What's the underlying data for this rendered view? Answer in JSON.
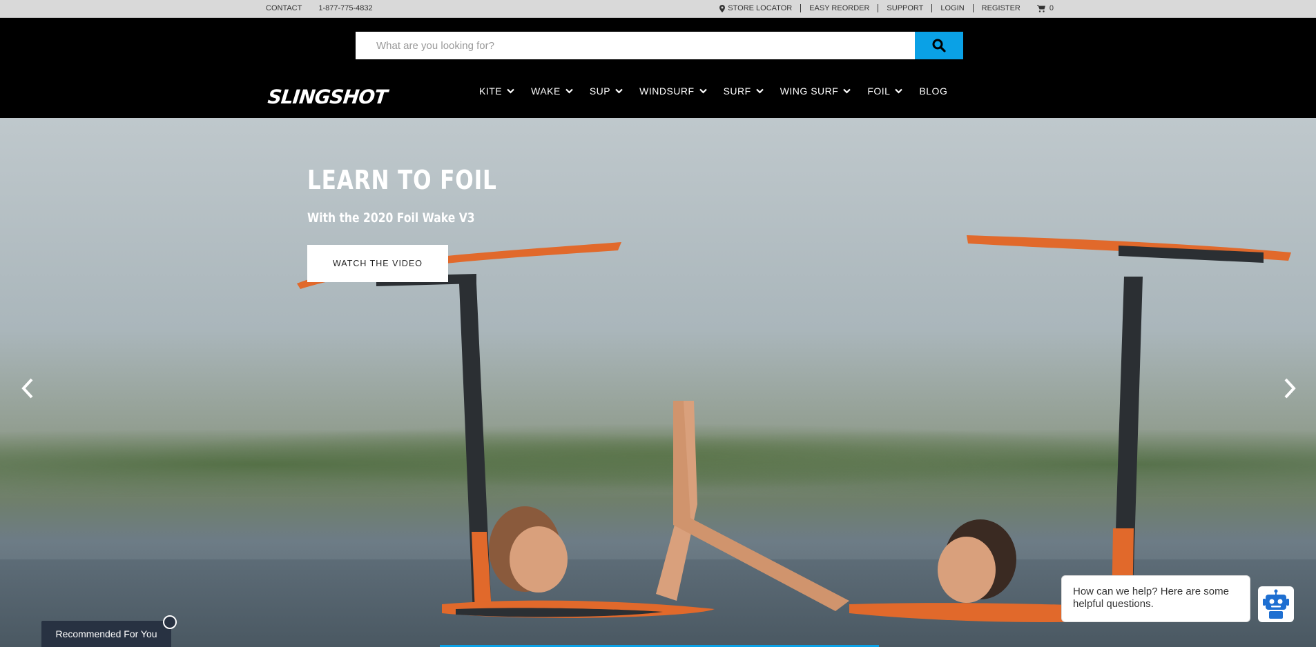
{
  "utility": {
    "contact": "CONTACT",
    "phone": "1-877-775-4832",
    "store_locator": "STORE LOCATOR",
    "easy_reorder": "EASY REORDER",
    "support": "SUPPORT",
    "login": "LOGIN",
    "register": "REGISTER",
    "cart_count": "0"
  },
  "search": {
    "placeholder": "What are you looking for?"
  },
  "brand": {
    "logo_text": "SLINGSHOT"
  },
  "nav": {
    "items": [
      {
        "label": "KITE"
      },
      {
        "label": "WAKE"
      },
      {
        "label": "SUP"
      },
      {
        "label": "WINDSURF"
      },
      {
        "label": "SURF"
      },
      {
        "label": "WING SURF"
      },
      {
        "label": "FOIL"
      },
      {
        "label": "BLOG"
      }
    ]
  },
  "hero": {
    "title": "LEARN TO FOIL",
    "subtitle": "With the 2020 Foil Wake V3",
    "cta": "WATCH THE VIDEO"
  },
  "chat": {
    "message": "How can we help? Here are some helpful questions."
  },
  "recommended": {
    "label": "Recommended For You"
  },
  "colors": {
    "accent": "#0aa1e6",
    "utility_bg": "#d9d9d9",
    "header_bg": "#000000",
    "recommended_bg": "#283242"
  },
  "icons": {
    "search": "search-icon",
    "map_pin": "map-pin-icon",
    "cart": "cart-icon",
    "chevron": "chevron-down-icon",
    "prev": "chevron-left-icon",
    "next": "chevron-right-icon",
    "chatbot": "robot-icon"
  }
}
